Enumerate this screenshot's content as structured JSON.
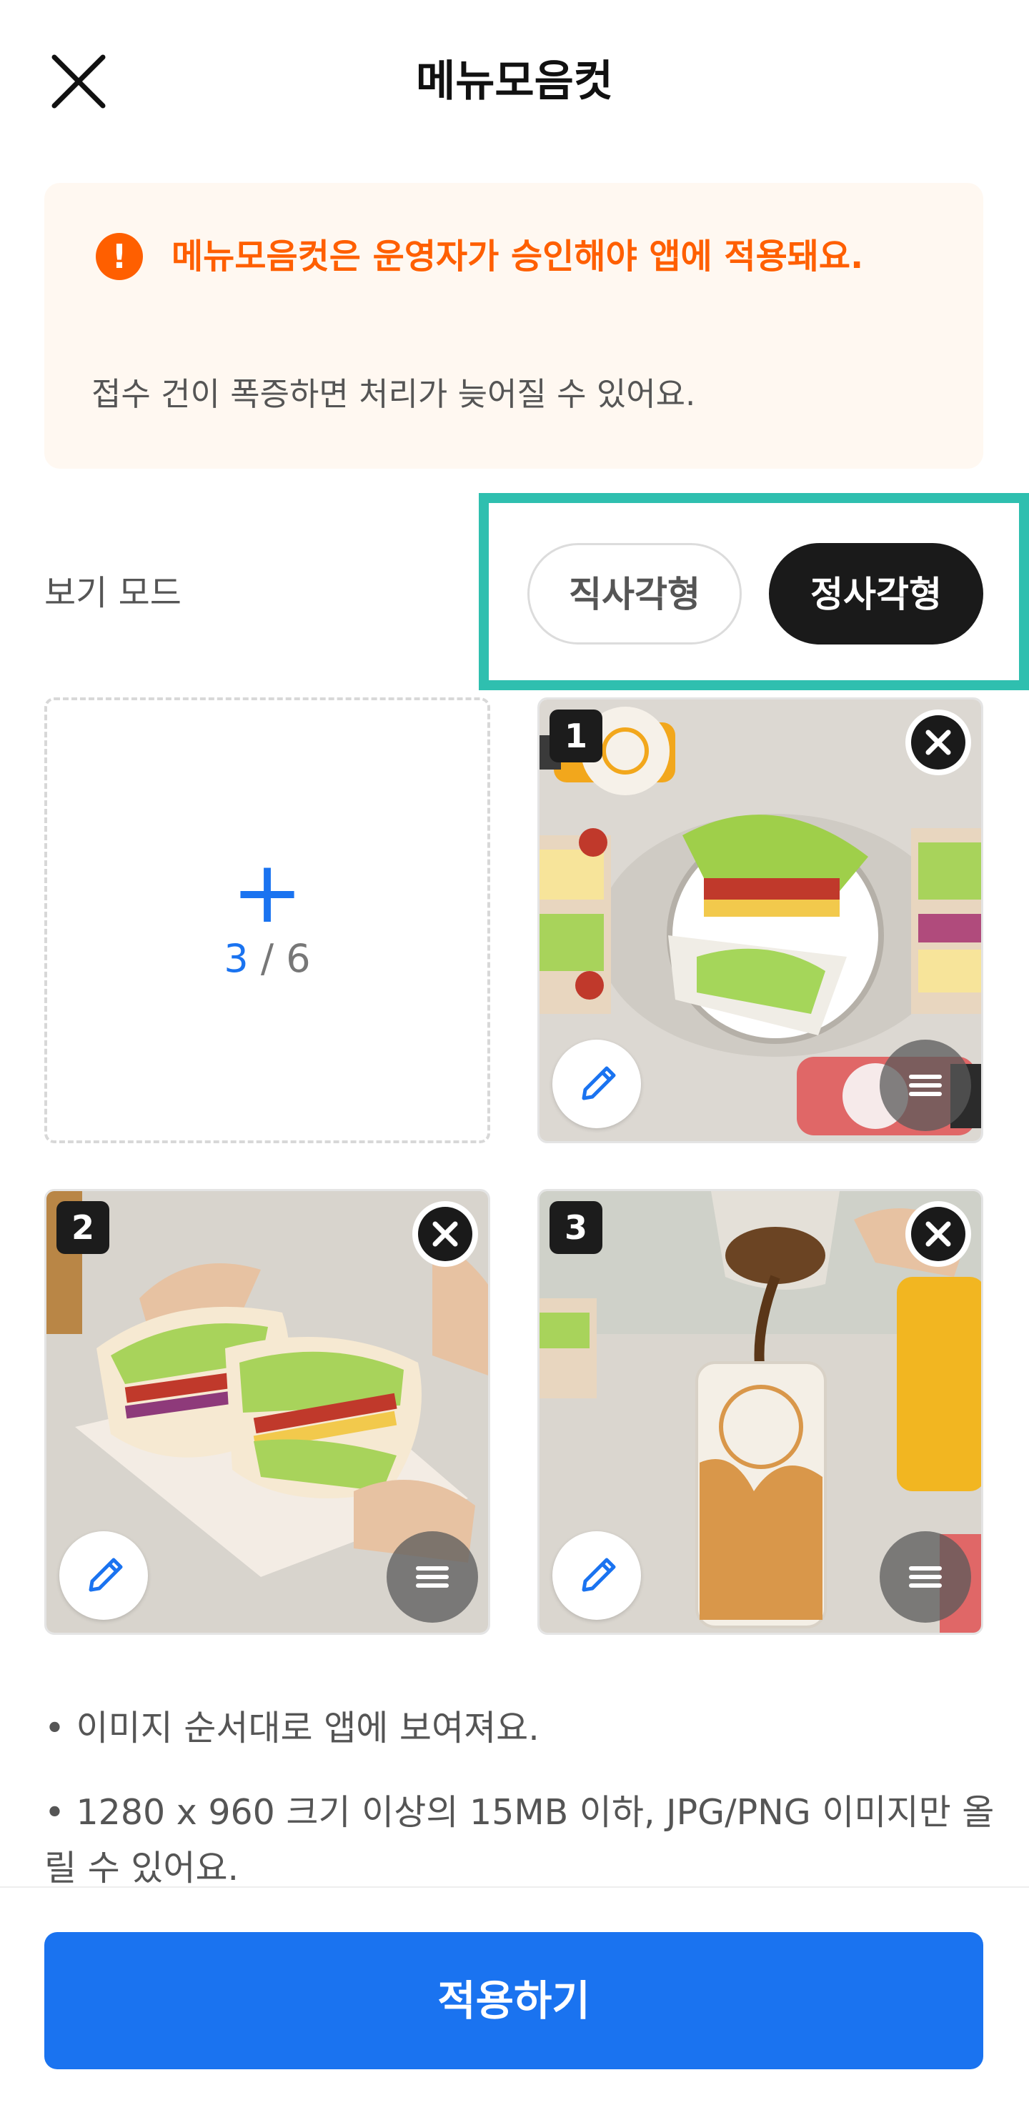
{
  "header": {
    "title": "메뉴모음컷"
  },
  "notice": {
    "title": "메뉴모음컷은 운영자가 승인해야 앱에 적용돼요.",
    "subtitle": "접수 건이 폭증하면 처리가 늦어질 수 있어요."
  },
  "view_mode": {
    "label": "보기 모드",
    "options": [
      "직사각형",
      "정사각형"
    ],
    "selected": "정사각형"
  },
  "upload": {
    "current": "3",
    "separator": " / ",
    "max": "6"
  },
  "images": [
    {
      "order": "1"
    },
    {
      "order": "2"
    },
    {
      "order": "3"
    }
  ],
  "info": [
    "• 이미지 순서대로 앱에 보여져요.",
    "• 1280 x 960 크기 이상의 15MB 이하, JPG/PNG 이미지만 올릴 수 있어요."
  ],
  "apply_label": "적용하기",
  "colors": {
    "accent": "#1a73f0",
    "warning": "#ff5f00",
    "highlight": "#2fbfaf"
  }
}
